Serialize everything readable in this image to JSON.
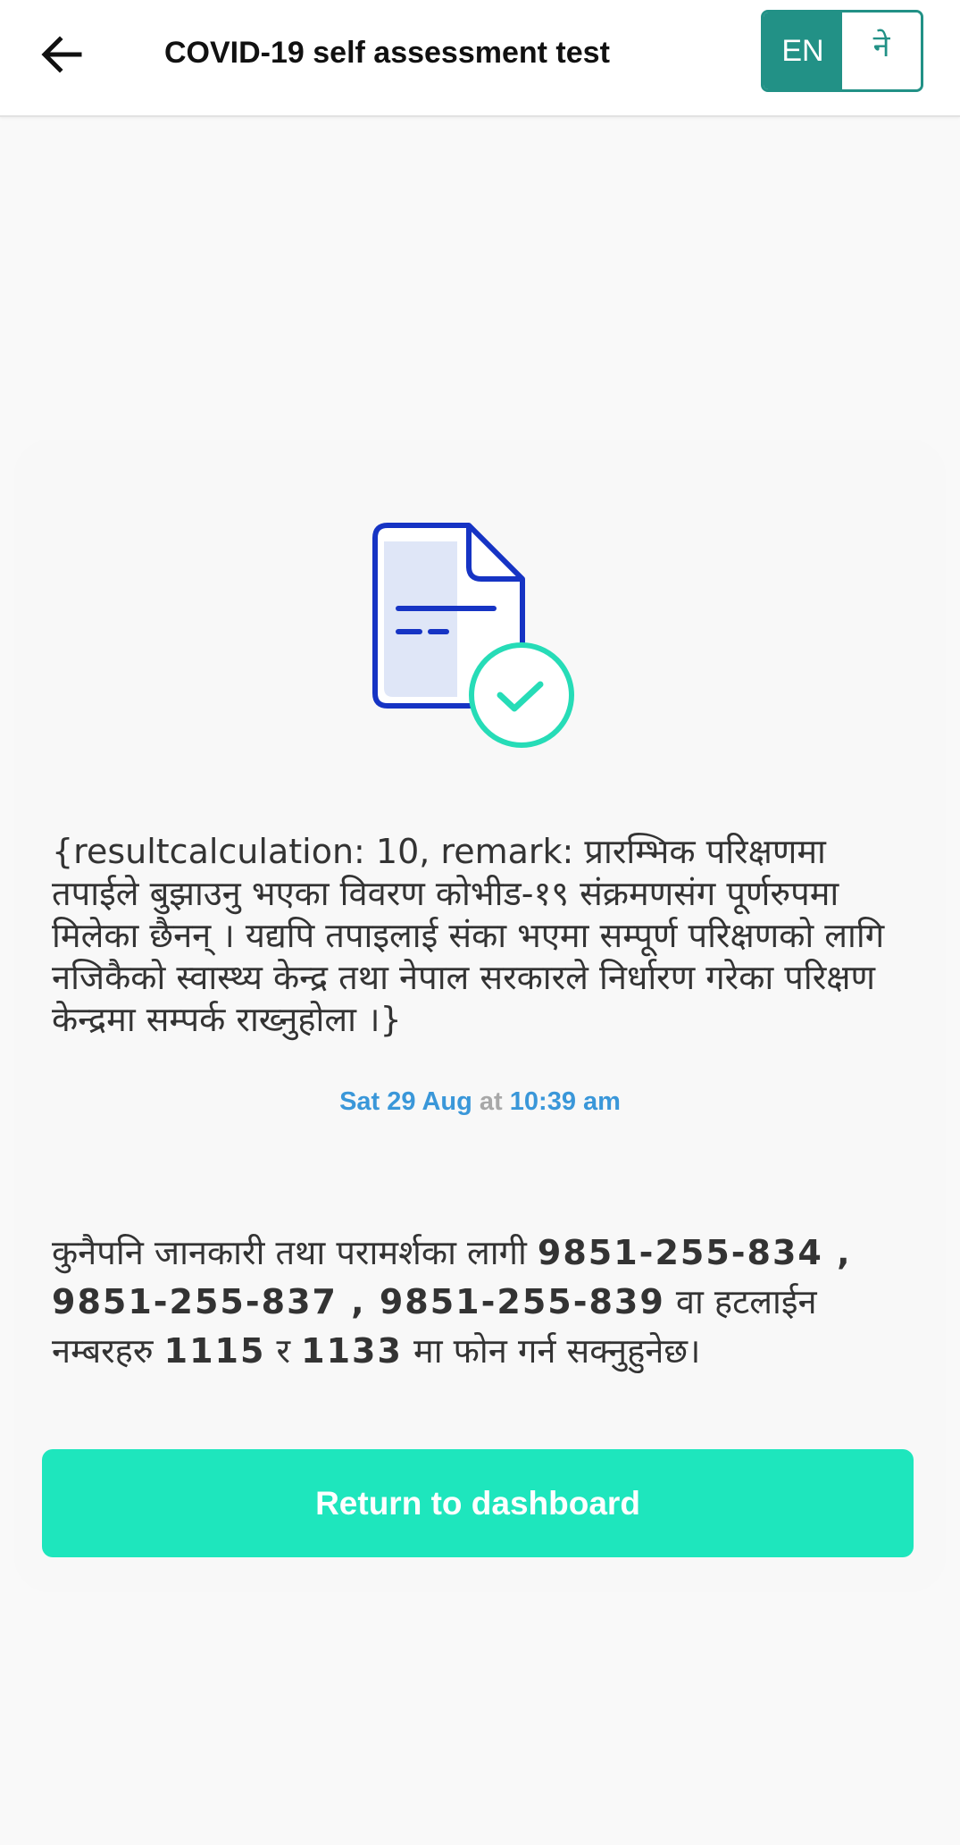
{
  "header": {
    "back_icon": "arrow-left-icon",
    "title": "COVID-19 self assessment test",
    "lang_en": "EN",
    "lang_ne": "ने"
  },
  "result": {
    "illustration_icon": "document-check-icon",
    "remark": "{resultcalculation: 10, remark: प्रारम्भिक परिक्षणमा तपाईले बुझाउनु भएका विवरण कोभीड-१९ संक्रमणसंग पूर्णरुपमा मिलेका छैनन् । यद्यपि तपाइलाई संका भएमा सम्पूर्ण परिक्षणको लागि नजिकैको स्वास्थ्य केन्द्र तथा नेपाल सरकारले निर्धारण गरेका परिक्षण केन्द्रमा सम्पर्क राख्नुहोला ।}",
    "date": "Sat 29 Aug",
    "at": "at",
    "time": "10:39 am"
  },
  "contact": {
    "prefix": "कुनैपनि जानकारी तथा परामर्शका लागी ",
    "phones": "9851-255-834 , 9851-255-837 , 9851-255-839",
    "middle": " वा हटलाईन नम्बरहरु ",
    "hotline1": "1115",
    "conj": " र ",
    "hotline2": "1133",
    "suffix": " मा फोन गर्न सक्नुहुनेछ।"
  },
  "actions": {
    "return_label": "Return to dashboard"
  },
  "colors": {
    "teal": "#229186",
    "mint": "#1ee6bd",
    "blue": "#3a97d9",
    "doc_blue": "#1634c4"
  }
}
